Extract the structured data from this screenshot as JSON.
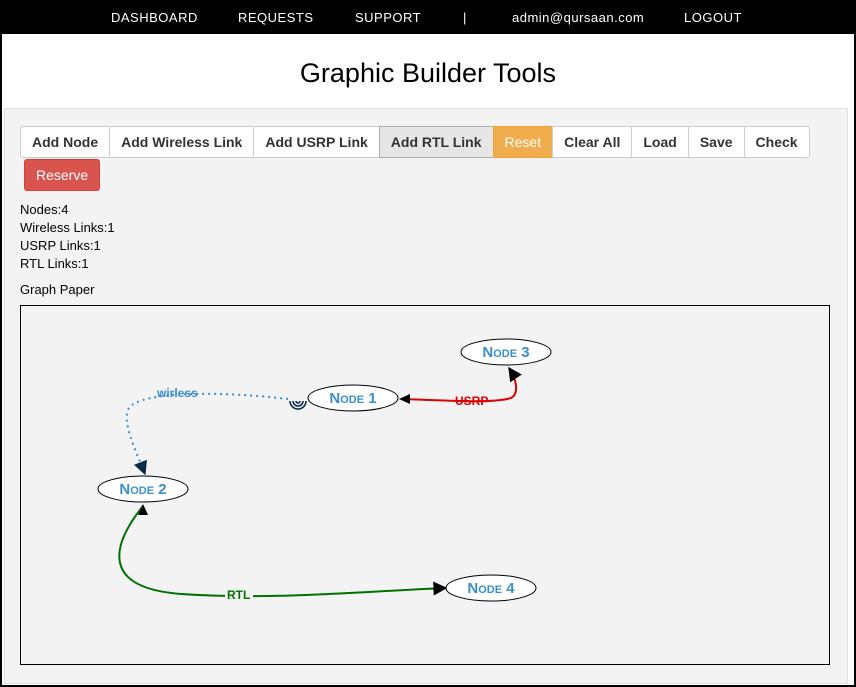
{
  "nav": {
    "dashboard": "DASHBOARD",
    "requests": "REQUESTS",
    "support": "SUPPORT",
    "separator": "|",
    "user": "admin@qursaan.com",
    "logout": "LOGOUT"
  },
  "page": {
    "title": "Graphic Builder Tools"
  },
  "toolbar": {
    "add_node": "Add Node",
    "add_wireless_link": "Add Wireless Link",
    "add_usrp_link": "Add USRP Link",
    "add_rtl_link": "Add RTL Link",
    "reset": "Reset",
    "clear_all": "Clear All",
    "load": "Load",
    "save": "Save",
    "check": "Check",
    "reserve": "Reserve"
  },
  "stats": {
    "nodes": "Nodes:4",
    "wireless_links": "Wireless Links:1",
    "usrp_links": "USRP Links:1",
    "rtl_links": "RTL Links:1"
  },
  "graph": {
    "label": "Graph Paper",
    "nodes": {
      "node1": {
        "n": "N",
        "ode": "ODE",
        "num": " 1"
      },
      "node2": {
        "n": "N",
        "ode": "ODE",
        "num": " 2"
      },
      "node3": {
        "n": "N",
        "ode": "ODE",
        "num": " 3"
      },
      "node4": {
        "n": "N",
        "ode": "ODE",
        "num": " 4"
      }
    },
    "links": {
      "wireless": "wirless",
      "usrp": "USRP",
      "rtl": "RTL"
    },
    "colors": {
      "wireless": "#3a8fd0",
      "usrp": "#e00000",
      "rtl": "#007000",
      "node_text": "#3a8fd0"
    }
  }
}
